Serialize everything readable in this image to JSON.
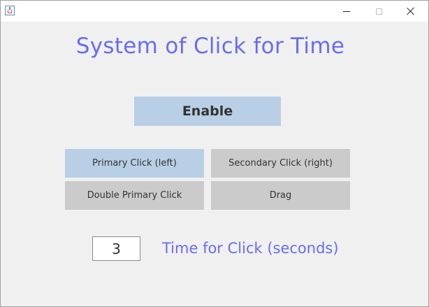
{
  "window": {
    "minimize_icon": "minimize-icon",
    "maximize_icon": "maximize-icon",
    "close_icon": "close-icon",
    "app_icon": "java-cup-icon"
  },
  "main": {
    "title": "System of Click for Time",
    "enable_label": "Enable",
    "modes": [
      {
        "label": "Primary Click (left)",
        "selected": true
      },
      {
        "label": "Secondary Click (right)",
        "selected": false
      },
      {
        "label": "Double Primary Click",
        "selected": false
      },
      {
        "label": "Drag",
        "selected": false
      }
    ],
    "time_value": "3",
    "time_label": "Time for Click (seconds)"
  },
  "colors": {
    "accent_text": "#6b6bef",
    "selected_button": "#b8cfe6",
    "unselected_button": "#cbcbcb",
    "background": "#f0f1f1"
  }
}
